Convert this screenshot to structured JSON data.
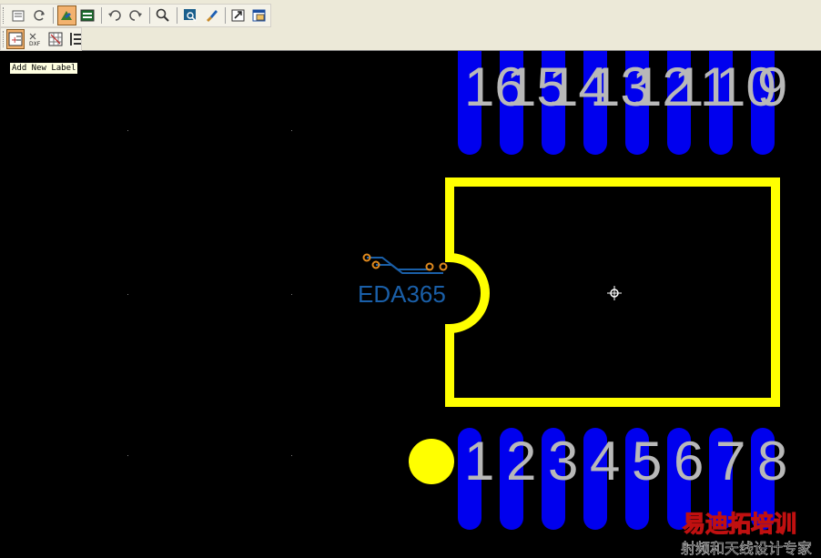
{
  "toolbars": {
    "row1": [
      {
        "name": "properties-icon"
      },
      {
        "name": "refresh-icon"
      },
      {
        "sep": true
      },
      {
        "name": "select-mode-icon",
        "active": true
      },
      {
        "name": "layer-display-icon"
      },
      {
        "sep": true
      },
      {
        "name": "undo-icon"
      },
      {
        "name": "redo-icon"
      },
      {
        "sep": true
      },
      {
        "name": "zoom-icon"
      },
      {
        "sep": true
      },
      {
        "name": "view-icon"
      },
      {
        "name": "brush-icon"
      },
      {
        "sep": true
      },
      {
        "name": "import-icon"
      },
      {
        "name": "window-icon"
      }
    ],
    "row2": [
      {
        "name": "add-label-icon",
        "active": true
      },
      {
        "name": "dxf-icon"
      },
      {
        "name": "grid-icon"
      },
      {
        "name": "list-icon"
      }
    ]
  },
  "tooltip": "Add New Label",
  "footprint": {
    "top_pins": [
      "16",
      "15",
      "14",
      "13",
      "12",
      "11",
      "10",
      "9"
    ],
    "bottom_pins": [
      "1",
      "2",
      "3",
      "4",
      "5",
      "6",
      "7",
      "8"
    ],
    "pin_count": 16,
    "colors": {
      "pad": "#0000ee",
      "outline": "#ffff00",
      "pin_label": "#b8b8b8",
      "pin1_marker": "#ffff00",
      "background": "#000000"
    }
  },
  "watermark": {
    "logo_text": "EDA365",
    "cn_title": "易迪拓培训",
    "cn_subtitle": "射频和天线设计专家",
    "color": "#1a5fa8",
    "cn_color": "#c01010"
  }
}
